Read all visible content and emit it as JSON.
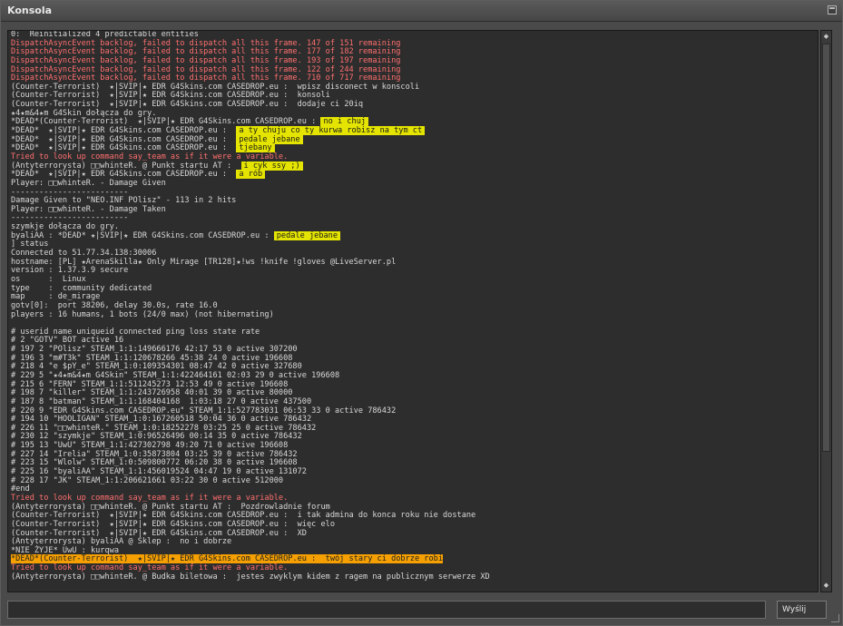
{
  "window": {
    "title": "Konsola",
    "send_label": "Wyślij",
    "input_value": ""
  },
  "colors": {
    "error": "#ff6f6f",
    "highlight": "#e4e400",
    "highlight_line": "#f5a000"
  },
  "console_lines": [
    {
      "type": "normal",
      "text": "0:  Reinitialized 4 predictable entities"
    },
    {
      "type": "err",
      "text": "DispatchAsyncEvent backlog, failed to dispatch all this frame. 147 of 151 remaining"
    },
    {
      "type": "err",
      "text": "DispatchAsyncEvent backlog, failed to dispatch all this frame. 177 of 182 remaining"
    },
    {
      "type": "err",
      "text": "DispatchAsyncEvent backlog, failed to dispatch all this frame. 193 of 197 remaining"
    },
    {
      "type": "err",
      "text": "DispatchAsyncEvent backlog, failed to dispatch all this frame. 122 of 244 remaining"
    },
    {
      "type": "err",
      "text": "DispatchAsyncEvent backlog, failed to dispatch all this frame. 710 of 717 remaining"
    },
    {
      "type": "normal",
      "text": "(Counter-Terrorist)  ★|SVIP|★ EDR G4Skins.com CASEDROP.eu :  wpisz disconect w konscoli"
    },
    {
      "type": "normal",
      "text": "(Counter-Terrorist)  ★|SVIP|★ EDR G4Skins.com CASEDROP.eu :  konsoli"
    },
    {
      "type": "normal",
      "text": "(Counter-Terrorist)  ★|SVIP|★ EDR G4Skins.com CASEDROP.eu :  dodaje ci 20iq"
    },
    {
      "type": "normal",
      "text": "★4★m&4★m G4Skin dołącza do gry."
    },
    {
      "type": "normal",
      "text": "*DEAD*(Counter-Terrorist)  ★|SVIP|★ EDR G4Skins.com CASEDROP.eu : ",
      "hl": "no i chuj"
    },
    {
      "type": "normal",
      "text": "*DEAD*  ★|SVIP|★ EDR G4Skins.com CASEDROP.eu :  ",
      "hl": "a ty chuju co ty kurwa robisz na tym ct"
    },
    {
      "type": "normal",
      "text": "*DEAD*  ★|SVIP|★ EDR G4Skins.com CASEDROP.eu :  ",
      "hl": "pedale jebane"
    },
    {
      "type": "normal",
      "text": "*DEAD*  ★|SVIP|★ EDR G4Skins.com CASEDROP.eu :  ",
      "hl": "tjebany"
    },
    {
      "type": "err",
      "text": "Tried to look up command say_team as if it were a variable."
    },
    {
      "type": "normal",
      "text": "(Antyterrorysta) □□whinteR. @ Punkt startu AT :  ",
      "hl": "i cyk ssy ;)"
    },
    {
      "type": "normal",
      "text": "*DEAD*  ★|SVIP|★ EDR G4Skins.com CASEDROP.eu :  ",
      "hl": "a rób"
    },
    {
      "type": "normal",
      "text": "Player: □□whinteR. - Damage Given"
    },
    {
      "type": "normal",
      "text": "-------------------------"
    },
    {
      "type": "normal",
      "text": "Damage Given to \"NEO.INF POlisz\" - 113 in 2 hits"
    },
    {
      "type": "normal",
      "text": "Player: □□whinteR. - Damage Taken"
    },
    {
      "type": "normal",
      "text": "-------------------------"
    },
    {
      "type": "normal",
      "text": "szymkje dołącza do gry."
    },
    {
      "type": "normal",
      "text": "byaliAA : *DEAD* ★|SVIP|★ EDR G4Skins.com CASEDROP.eu : ",
      "hl": "pedale jebane"
    },
    {
      "type": "normal",
      "text": "] status"
    },
    {
      "type": "normal",
      "text": "Connected to 51.77.34.138:30006"
    },
    {
      "type": "normal",
      "text": "hostname: [PL] ★ArenaSkilla★ Only Mirage [TR128]★!ws !knife !gloves @LiveServer.pl"
    },
    {
      "type": "normal",
      "text": "version : 1.37.3.9 secure"
    },
    {
      "type": "normal",
      "text": "os      :  Linux"
    },
    {
      "type": "normal",
      "text": "type    :  community dedicated"
    },
    {
      "type": "normal",
      "text": "map     : de_mirage"
    },
    {
      "type": "normal",
      "text": "gotv[0]:  port 38206, delay 30.0s, rate 16.0"
    },
    {
      "type": "normal",
      "text": "players : 16 humans, 1 bots (24/0 max) (not hibernating)"
    },
    {
      "type": "normal",
      "text": ""
    },
    {
      "type": "normal",
      "text": "# userid name uniqueid connected ping loss state rate"
    },
    {
      "type": "normal",
      "text": "# 2 \"GOTV\" BOT active 16"
    },
    {
      "type": "normal",
      "text": "# 197 2 \"POlisz\" STEAM_1:1:149666176 42:17 53 0 active 307200"
    },
    {
      "type": "normal",
      "text": "# 196 3 \"m#T3k\" STEAM_1:1:120678266 45:38 24 0 active 196608"
    },
    {
      "type": "normal",
      "text": "# 218 4 \"e $pY_e\" STEAM_1:0:109354301 08:47 42 0 active 327680"
    },
    {
      "type": "normal",
      "text": "# 229 5 \"★4★m&4★m G4Skin\" STEAM_1:1:422464161 02:03 29 0 active 196608"
    },
    {
      "type": "normal",
      "text": "# 215 6 \"FERN\" STEAM_1:1:511245273 12:53 49 0 active 196608"
    },
    {
      "type": "normal",
      "text": "# 198 7 \"killer\" STEAM_1:1:243726958 40:01 39 0 active 80000"
    },
    {
      "type": "normal",
      "text": "# 187 8 \"batman\" STEAM_1:1:168404168  1:03:18 27 0 active 437500"
    },
    {
      "type": "normal",
      "text": "# 220 9 \"EDR G4Skins.com CASEDROP.eu\" STEAM_1:1:527783031 06:53 33 0 active 786432"
    },
    {
      "type": "normal",
      "text": "# 194 10 \"HOOLIGAN\" STEAM_1:0:167260518 50:04 36 0 active 786432"
    },
    {
      "type": "normal",
      "text": "# 226 11 \"□□whinteR.\" STEAM_1:0:18252278 03:25 25 0 active 786432"
    },
    {
      "type": "normal",
      "text": "# 230 12 \"szymkje\" STEAM_1:0:96526496 00:14 35 0 active 786432"
    },
    {
      "type": "normal",
      "text": "# 195 13 \"UwU\" STEAM_1:1:427302798 49:20 71 0 active 196608"
    },
    {
      "type": "normal",
      "text": "# 227 14 \"Irelia\" STEAM_1:0:35873804 03:25 39 0 active 786432"
    },
    {
      "type": "normal",
      "text": "# 223 15 \"Wlolw\" STEAM_1:0:509800772 06:20 38 0 active 196608"
    },
    {
      "type": "normal",
      "text": "# 225 16 \"byaliAA\" STEAM_1:1:456019524 04:47 19 0 active 131072"
    },
    {
      "type": "normal",
      "text": "# 228 17 \"JK\" STEAM_1:1:206621661 03:22 30 0 active 512000"
    },
    {
      "type": "normal",
      "text": "#end"
    },
    {
      "type": "err",
      "text": "Tried to look up command say_team as if it were a variable."
    },
    {
      "type": "normal",
      "text": "(Antyterrorysta) □□whinteR. @ Punkt startu AT :  Pozdrowladnie forum"
    },
    {
      "type": "normal",
      "text": "(Counter-Terrorist)  ★|SVIP|★ EDR G4Skins.com CASEDROP.eu :  i tak admina do konca roku nie dostane"
    },
    {
      "type": "normal",
      "text": "(Counter-Terrorist)  ★|SVIP|★ EDR G4Skins.com CASEDROP.eu :  więc elo"
    },
    {
      "type": "normal",
      "text": "(Counter-Terrorist)  ★|SVIP|★ EDR G4Skins.com CASEDROP.eu :  XD"
    },
    {
      "type": "normal",
      "text": "(Antyterrorysta) byaliAA @ Sklep :  no i dobrze"
    },
    {
      "type": "normal",
      "text": "*NIE ŻYJE* UwU : kurqwa"
    },
    {
      "type": "hlline",
      "text": "*DEAD*(Counter-Terrorist)  ★|SVIP|★ EDR G4Skins.com CASEDROP.eu :  twój stary ci dobrze robi"
    },
    {
      "type": "err",
      "text": "Tried to look up command say_team as if it were a variable."
    },
    {
      "type": "normal",
      "text": "(Antyterrorysta) □□whinteR. @ Budka biletowa :  jestes zwyklym kidem z ragem na publicznym serwerze XD"
    }
  ]
}
